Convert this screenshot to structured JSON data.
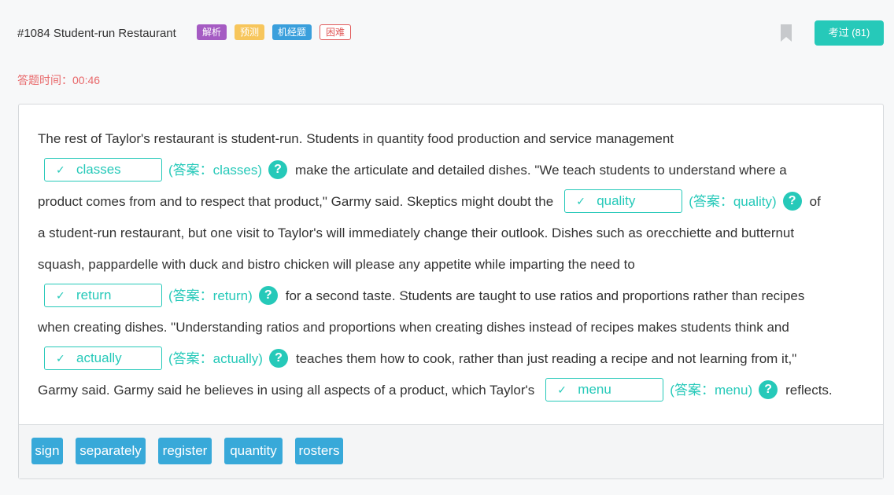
{
  "header": {
    "title": "#1084 Student-run Restaurant",
    "tags": [
      "解析",
      "预测",
      "机经题",
      "困难"
    ],
    "passed_label": "考过 (81)"
  },
  "timer": "答题时间：00:46",
  "colors": {
    "accent": "#26c9b9",
    "word_chip": "#38a9d9",
    "timer": "#e8686a"
  },
  "icons": {
    "bookmark": "bookmark-icon",
    "check": "check-icon",
    "help": "question-icon"
  },
  "passage": {
    "t1": "The rest of Taylor's restaurant is student-run. Students in quantity food production and service management",
    "t2": "make the articulate and detailed dishes. \"We teach students to understand where a",
    "t3": "product comes from and to respect that product,\" Garmy said. Skeptics might doubt the",
    "t4": "of",
    "t5": "a student-run restaurant, but one visit to Taylor's will immediately change their outlook. Dishes such as orecchiette and butternut",
    "t6": "squash, pappardelle with duck and bistro chicken will please any appetite while imparting the need to",
    "t7": "for a second taste. Students are taught to use ratios and proportions rather than recipes",
    "t8": "when creating dishes. \"Understanding ratios and proportions when creating dishes instead of recipes makes students think and",
    "t9": "teaches them how to cook, rather than just reading a recipe and not learning from it,\"",
    "t10": "Garmy said. Garmy said he believes in using all aspects of a product, which Taylor's",
    "t11": "reflects."
  },
  "blanks": [
    {
      "value": "classes",
      "answer": "(答案：classes)"
    },
    {
      "value": "quality",
      "answer": "(答案：quality)"
    },
    {
      "value": "return",
      "answer": "(答案：return)"
    },
    {
      "value": "actually",
      "answer": "(答案：actually)"
    },
    {
      "value": "menu",
      "answer": "(答案：menu)"
    }
  ],
  "check_glyph": "✓",
  "help_glyph": "?",
  "word_bank": [
    "sign",
    "separately",
    "register",
    "quantity",
    "rosters"
  ]
}
